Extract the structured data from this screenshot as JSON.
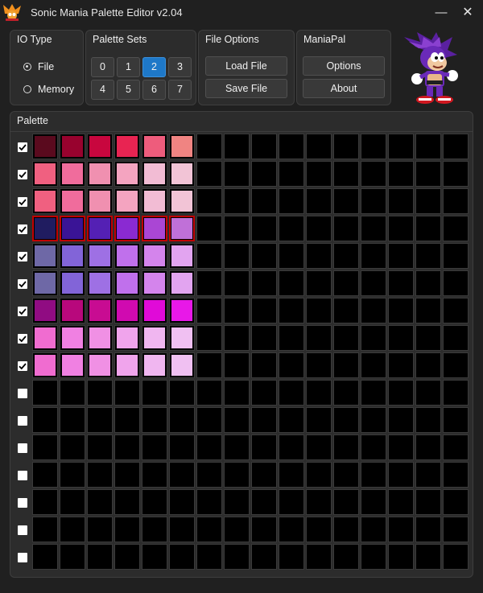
{
  "window": {
    "title": "Sonic Mania Palette Editor v2.04",
    "minimize_label": "—",
    "close_label": "✕"
  },
  "io_type": {
    "title": "IO Type",
    "options": [
      "File",
      "Memory"
    ],
    "selected": "File"
  },
  "palette_sets": {
    "title": "Palette Sets",
    "buttons": [
      "0",
      "1",
      "2",
      "3",
      "4",
      "5",
      "6",
      "7"
    ],
    "active": "2"
  },
  "file_options": {
    "title": "File Options",
    "load_label": "Load File",
    "save_label": "Save File"
  },
  "maniapal": {
    "title": "ManiaPal",
    "options_label": "Options",
    "about_label": "About"
  },
  "palette": {
    "title": "Palette",
    "selected_row": 3,
    "columns": 16,
    "rows": [
      {
        "checked": true,
        "colors": [
          "#5a0a1e",
          "#98022e",
          "#c8063e",
          "#e82452",
          "#ee5c7c",
          "#f08482"
        ]
      },
      {
        "checked": true,
        "colors": [
          "#f06080",
          "#f06c9c",
          "#f090b0",
          "#f4a4c0",
          "#f2bcd4",
          "#f2c4d6"
        ]
      },
      {
        "checked": true,
        "colors": [
          "#f06080",
          "#f06c9c",
          "#f090b0",
          "#f4a4c0",
          "#f2bcd4",
          "#f2c4d6"
        ]
      },
      {
        "checked": true,
        "colors": [
          "#201c60",
          "#3a1496",
          "#5420b4",
          "#8a2ad2",
          "#aa46d4",
          "#c070d8"
        ]
      },
      {
        "checked": true,
        "colors": [
          "#6e68a6",
          "#8264d8",
          "#9e70e4",
          "#c070ec",
          "#d484ec",
          "#e2a4f0"
        ]
      },
      {
        "checked": true,
        "colors": [
          "#6e68a6",
          "#8264d8",
          "#9e70e4",
          "#c070ec",
          "#d484ec",
          "#e2a4f0"
        ]
      },
      {
        "checked": true,
        "colors": [
          "#900c82",
          "#b8087c",
          "#c80c92",
          "#d00ab0",
          "#e00ad8",
          "#e818e8"
        ]
      },
      {
        "checked": true,
        "colors": [
          "#f06cd0",
          "#f080e2",
          "#f090e4",
          "#f0a4ec",
          "#f0b6f0",
          "#f0c0f2"
        ]
      },
      {
        "checked": true,
        "colors": [
          "#f06cd0",
          "#f080e2",
          "#f090e4",
          "#f0a4ec",
          "#f0b6f0",
          "#f0c0f2"
        ]
      },
      {
        "checked": false,
        "colors": []
      },
      {
        "checked": false,
        "colors": []
      },
      {
        "checked": false,
        "colors": []
      },
      {
        "checked": false,
        "colors": []
      },
      {
        "checked": false,
        "colors": []
      },
      {
        "checked": false,
        "colors": []
      },
      {
        "checked": false,
        "colors": []
      }
    ]
  }
}
